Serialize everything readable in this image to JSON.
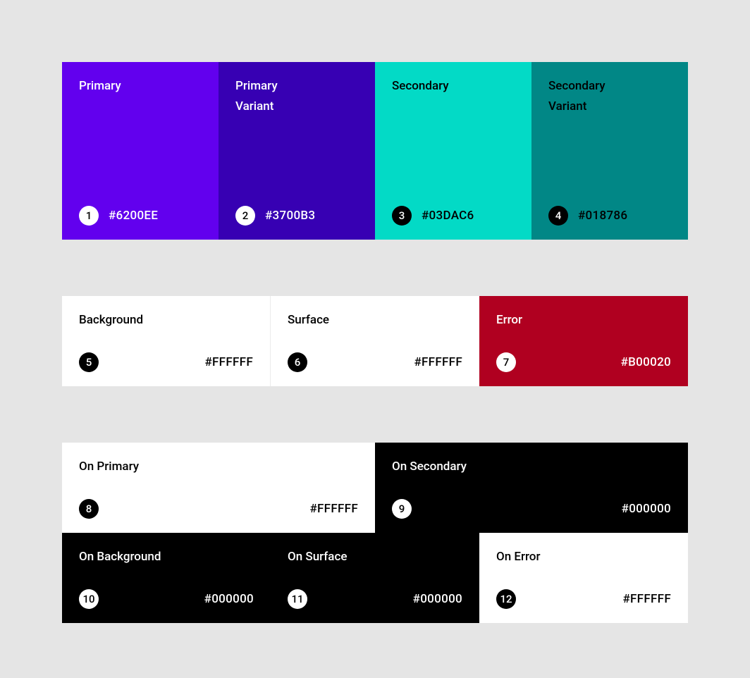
{
  "swatches": {
    "primary": {
      "num": "1",
      "label": "Primary",
      "hex": "#6200EE",
      "bg": "#6200EE",
      "fg": "#FFFFFF",
      "badge": "light",
      "layout": "stack"
    },
    "primaryVariant": {
      "num": "2",
      "label": "Primary Variant",
      "hex": "#3700B3",
      "bg": "#3700B3",
      "fg": "#FFFFFF",
      "badge": "light",
      "layout": "stack"
    },
    "secondary": {
      "num": "3",
      "label": "Secondary",
      "hex": "#03DAC6",
      "bg": "#03DAC6",
      "fg": "#000000",
      "badge": "dark",
      "layout": "stack"
    },
    "secondaryVariant": {
      "num": "4",
      "label": "Secondary Variant",
      "hex": "#018786",
      "bg": "#018786",
      "fg": "#000000",
      "badge": "dark",
      "layout": "stack"
    },
    "background": {
      "num": "5",
      "label": "Background",
      "hex": "#FFFFFF",
      "bg": "#FFFFFF",
      "fg": "#000000",
      "badge": "dark",
      "layout": "spread"
    },
    "surface": {
      "num": "6",
      "label": "Surface",
      "hex": "#FFFFFF",
      "bg": "#FFFFFF",
      "fg": "#000000",
      "badge": "dark",
      "layout": "spread"
    },
    "error": {
      "num": "7",
      "label": "Error",
      "hex": "#B00020",
      "bg": "#B00020",
      "fg": "#FFFFFF",
      "badge": "light",
      "layout": "spread"
    },
    "onPrimary": {
      "num": "8",
      "label": "On Primary",
      "hex": "#FFFFFF",
      "bg": "#FFFFFF",
      "fg": "#000000",
      "badge": "dark",
      "layout": "spread"
    },
    "onSecondary": {
      "num": "9",
      "label": "On Secondary",
      "hex": "#000000",
      "bg": "#000000",
      "fg": "#FFFFFF",
      "badge": "light",
      "layout": "spread"
    },
    "onBackground": {
      "num": "10",
      "label": "On Background",
      "hex": "#000000",
      "bg": "#000000",
      "fg": "#FFFFFF",
      "badge": "light",
      "layout": "spread"
    },
    "onSurface": {
      "num": "11",
      "label": "On Surface",
      "hex": "#000000",
      "bg": "#000000",
      "fg": "#FFFFFF",
      "badge": "light",
      "layout": "spread"
    },
    "onError": {
      "num": "12",
      "label": "On Error",
      "hex": "#FFFFFF",
      "bg": "#FFFFFF",
      "fg": "#000000",
      "badge": "dark",
      "layout": "spread"
    }
  }
}
